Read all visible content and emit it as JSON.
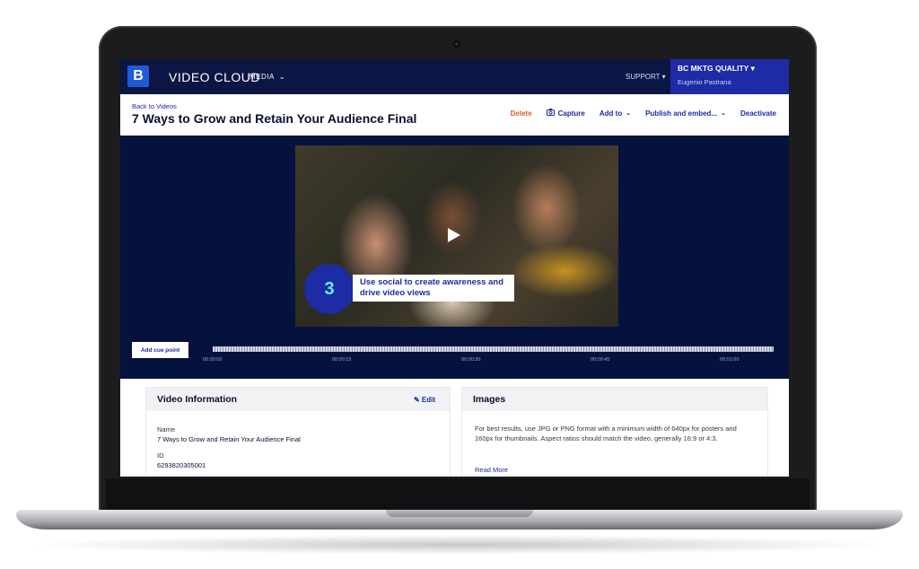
{
  "nav": {
    "logo_letter": "B",
    "app_name": "VIDEO CLOUD",
    "media_menu": "MEDIA",
    "support_menu": "SUPPORT",
    "account_name": "BC MKTG QUALITY",
    "account_user": "Eugenio Pastrana"
  },
  "header": {
    "back_link": "Back to Videos",
    "title": "7 Ways to Grow and Retain Your Audience Final",
    "actions": {
      "delete": "Delete",
      "capture": "Capture",
      "add_to": "Add to",
      "publish": "Publish and embed...",
      "deactivate": "Deactivate"
    }
  },
  "player": {
    "step_number": "3",
    "overlay_text": "Use social to create awareness and drive video views"
  },
  "cue": {
    "button_label": "Add cue point",
    "time_labels": [
      "00:00:00",
      "00:00:15",
      "00:00:30",
      "00:00:45",
      "00:01:00"
    ]
  },
  "video_info": {
    "heading": "Video Information",
    "edit_label": "Edit",
    "name_label": "Name",
    "name_value": "7 Ways to Grow and Retain Your Audience Final",
    "id_label": "ID",
    "id_value": "6293820305001"
  },
  "images": {
    "heading": "Images",
    "description": "For best results, use JPG or PNG format with a minimum width of 640px for posters and 160px for thumbnails. Aspect ratios should match the video, generally 16:9 or 4:3.",
    "read_more": "Read More"
  },
  "colors": {
    "nav_bg": "#0b1645",
    "accent": "#1d2ba4",
    "delete": "#e05b2a",
    "highlight": "#5ff0ea"
  }
}
